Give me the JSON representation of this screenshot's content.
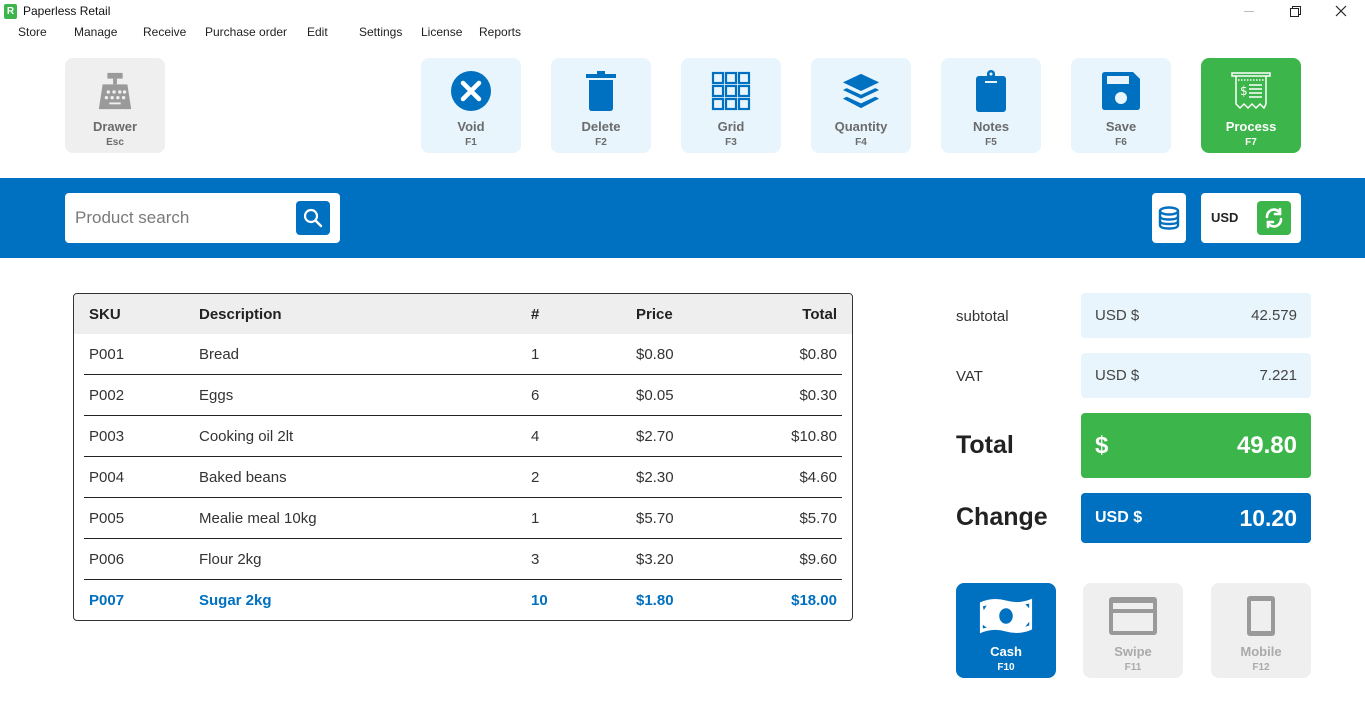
{
  "window": {
    "title": "Paperless Retail",
    "logo_glyph": "R"
  },
  "menu": [
    {
      "label": "Store"
    },
    {
      "label": "Manage"
    },
    {
      "label": "Receive"
    },
    {
      "label": "Purchase order"
    },
    {
      "label": "Edit"
    },
    {
      "label": "Settings"
    },
    {
      "label": "License"
    },
    {
      "label": "Reports"
    }
  ],
  "toolbar": {
    "drawer": {
      "label": "Drawer",
      "key": "Esc",
      "icon": "cash-register-icon"
    },
    "void": {
      "label": "Void",
      "key": "F1",
      "icon": "close-circle-icon"
    },
    "delete": {
      "label": "Delete",
      "key": "F2",
      "icon": "trash-icon"
    },
    "grid": {
      "label": "Grid",
      "key": "F3",
      "icon": "grid-icon"
    },
    "quantity": {
      "label": "Quantity",
      "key": "F4",
      "icon": "layers-icon"
    },
    "notes": {
      "label": "Notes",
      "key": "F5",
      "icon": "clipboard-icon"
    },
    "save": {
      "label": "Save",
      "key": "F6",
      "icon": "floppy-disk-icon"
    },
    "process": {
      "label": "Process",
      "key": "F7",
      "icon": "receipt-icon"
    }
  },
  "search": {
    "placeholder": "Product search",
    "value": ""
  },
  "currency": {
    "code": "USD"
  },
  "table": {
    "headers": {
      "sku": "SKU",
      "description": "Description",
      "qty": "#",
      "price": "Price",
      "total": "Total"
    },
    "rows": [
      {
        "sku": "P001",
        "description": "Bread",
        "qty": "1",
        "price": "$0.80",
        "total": "$0.80"
      },
      {
        "sku": "P002",
        "description": "Eggs",
        "qty": "6",
        "price": "$0.05",
        "total": "$0.30"
      },
      {
        "sku": "P003",
        "description": "Cooking oil 2lt",
        "qty": "4",
        "price": "$2.70",
        "total": "$10.80"
      },
      {
        "sku": "P004",
        "description": "Baked beans",
        "qty": "2",
        "price": "$2.30",
        "total": "$4.60"
      },
      {
        "sku": "P005",
        "description": "Mealie meal 10kg",
        "qty": "1",
        "price": "$5.70",
        "total": "$5.70"
      },
      {
        "sku": "P006",
        "description": "Flour 2kg",
        "qty": "3",
        "price": "$3.20",
        "total": "$9.60"
      },
      {
        "sku": "P007",
        "description": "Sugar 2kg",
        "qty": "10",
        "price": "$1.80",
        "total": "$18.00",
        "selected": true
      }
    ]
  },
  "summary": {
    "subtotal": {
      "label": "subtotal",
      "currency": "USD $",
      "value": "42.579"
    },
    "vat": {
      "label": "VAT",
      "currency": "USD $",
      "value": "7.221"
    },
    "total": {
      "label": "Total",
      "currency": "$",
      "value": "49.80"
    },
    "change": {
      "label": "Change",
      "currency": "USD $",
      "value": "10.20"
    }
  },
  "payment": {
    "cash": {
      "label": "Cash",
      "key": "F10",
      "active": true
    },
    "swipe": {
      "label": "Swipe",
      "key": "F11",
      "active": false
    },
    "mobile": {
      "label": "Mobile",
      "key": "F12",
      "active": false
    }
  },
  "colors": {
    "brand_blue": "#0070c0",
    "brand_green": "#3cb54a",
    "tile_light": "#e8f5fd",
    "tile_gray": "#efefef"
  }
}
